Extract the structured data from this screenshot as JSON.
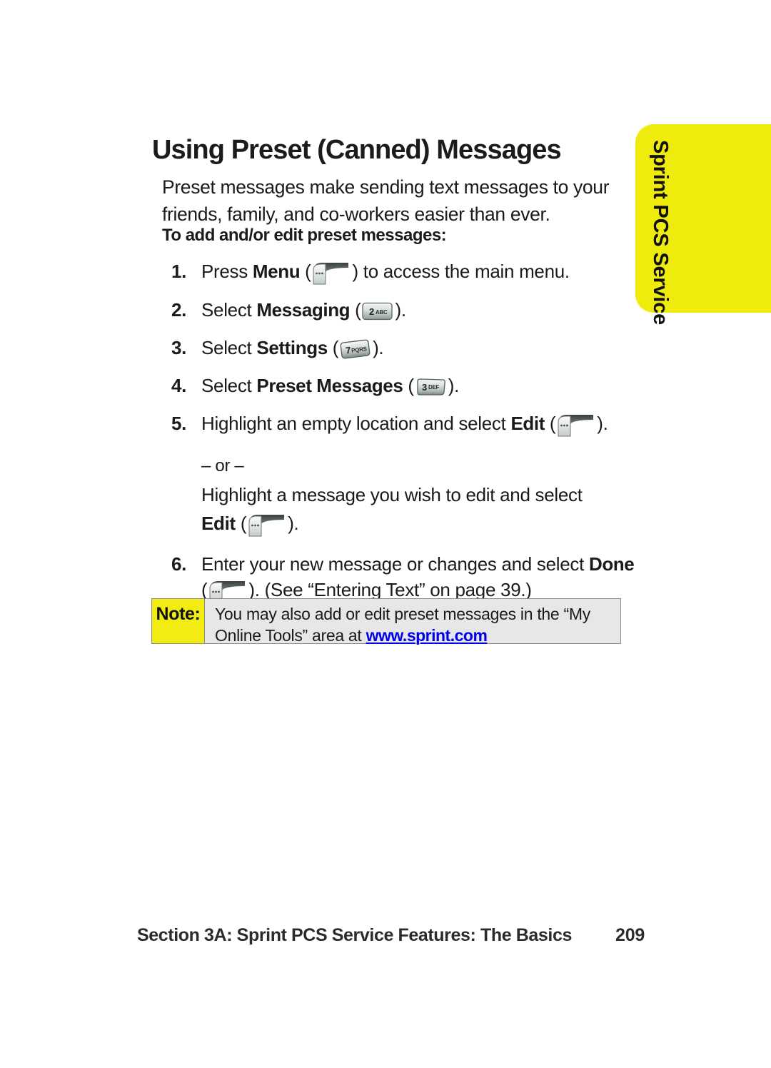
{
  "page": {
    "side_tab_label": "Sprint PCS Service",
    "heading": "Using Preset (Canned) Messages",
    "intro": "Preset messages make sending text messages to your friends, family, and co-workers easier than ever.",
    "subheading": "To add and/or edit preset messages:"
  },
  "steps": [
    {
      "num": "1.",
      "pre": "Press ",
      "bold": "Menu",
      "mid": " (",
      "icon": "softkey-icon",
      "post": ") to access the main menu."
    },
    {
      "num": "2.",
      "pre": "Select ",
      "bold": "Messaging",
      "mid": " (",
      "icon": "key-2-abc-icon",
      "key_digit": "2",
      "key_letters": "ABC",
      "post": ")."
    },
    {
      "num": "3.",
      "pre": "Select ",
      "bold": "Settings",
      "mid": " (",
      "icon": "key-7-pqrs-icon",
      "key_digit": "7",
      "key_letters": "PQRS",
      "post": ")."
    },
    {
      "num": "4.",
      "pre": "Select ",
      "bold": "Preset Messages",
      "mid": " (",
      "icon": "key-3-def-icon",
      "key_digit": "3",
      "key_letters": "DEF",
      "post": ")."
    },
    {
      "num": "5.",
      "pre": "Highlight an empty location and select ",
      "bold": "Edit",
      "mid": " (",
      "icon": "softkey-icon",
      "post": ")."
    },
    {
      "num": "6.",
      "pre": "Enter your new message or changes and select ",
      "bold": "Done",
      "mid": "",
      "icon": "softkey-icon",
      "post": ""
    }
  ],
  "alternative": {
    "or_label": "– or –",
    "line": "Highlight a message you wish to edit and select",
    "bold": "Edit",
    "open_paren": " (",
    "close_paren": ")."
  },
  "step6_second_line": {
    "open_paren": "(",
    "close_paren": "). (See “Entering Text” on page 39.)"
  },
  "note": {
    "label": "Note:",
    "text_before_link": "You may also add or edit preset messages in the “My Online Tools” area at ",
    "link": "www.sprint.com"
  },
  "footer": {
    "section": "Section 3A: Sprint PCS Service Features: The Basics",
    "page_number": "209"
  },
  "colors": {
    "tab_yellow": "#efeb0c",
    "note_yellow": "#f2ec12",
    "note_gray": "#e7e7e7",
    "note_border": "#8c8c8c",
    "text": "#1a1a1a"
  }
}
